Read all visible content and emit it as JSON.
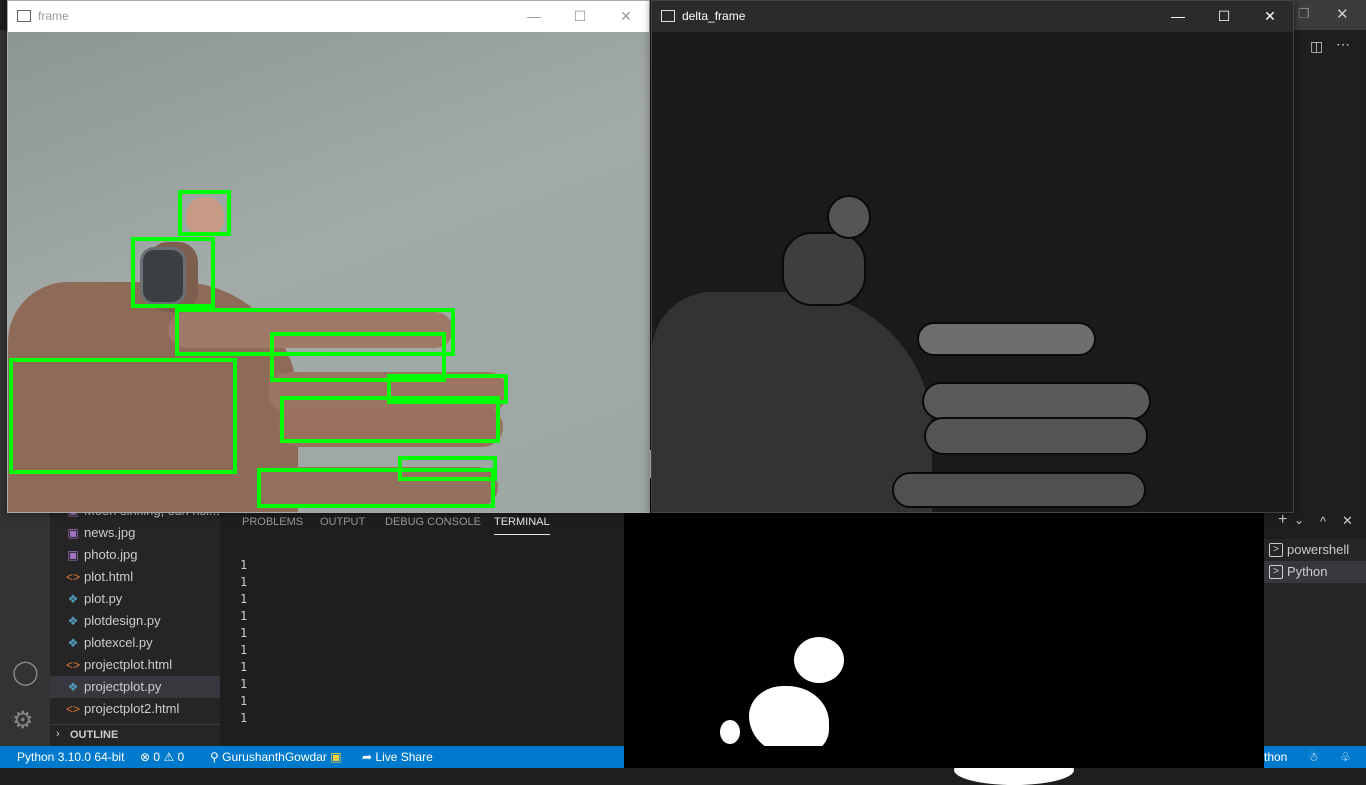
{
  "frame_window": {
    "title": "frame",
    "controls": {
      "minimize": "—",
      "maximize": "☐",
      "close": "✕"
    },
    "detection_count": 10,
    "detection_color": "#00ff00"
  },
  "delta_window": {
    "title": "delta_frame",
    "controls": {
      "minimize": "—",
      "maximize": "☐",
      "close": "✕"
    }
  },
  "explorer": {
    "partial_item": "Moon sinking, sun risi...",
    "files": [
      {
        "name": "news.jpg",
        "icon": "image-file-icon"
      },
      {
        "name": "photo.jpg",
        "icon": "image-file-icon"
      },
      {
        "name": "plot.html",
        "icon": "html-file-icon"
      },
      {
        "name": "plot.py",
        "icon": "python-file-icon"
      },
      {
        "name": "plotdesign.py",
        "icon": "python-file-icon"
      },
      {
        "name": "plotexcel.py",
        "icon": "python-file-icon"
      },
      {
        "name": "projectplot.html",
        "icon": "html-file-icon"
      },
      {
        "name": "projectplot.py",
        "icon": "python-file-icon",
        "selected": true
      },
      {
        "name": "projectplot2.html",
        "icon": "html-file-icon"
      }
    ],
    "outline_label": "OUTLINE"
  },
  "panel": {
    "tabs": [
      "PROBLEMS",
      "OUTPUT",
      "DEBUG CONSOLE",
      "TERMINAL"
    ],
    "active_tab": "TERMINAL",
    "terminal_lines": [
      "1",
      "1",
      "1",
      "1",
      "1",
      "1",
      "1",
      "1",
      "1",
      "1"
    ]
  },
  "terminal_list": {
    "items": [
      {
        "label": "powershell",
        "active": false
      },
      {
        "label": "Python",
        "active": true
      }
    ],
    "toolbar": {
      "add": "+",
      "dropdown": "⌄",
      "maximize": "^",
      "close": "✕"
    }
  },
  "status_bar": {
    "interpreter": "Python 3.10.0 64-bit",
    "errors": "0",
    "warnings": "0",
    "account": "GurushanthGowdar",
    "live_share": "Live Share",
    "language": "Python",
    "background": "#007acc"
  }
}
